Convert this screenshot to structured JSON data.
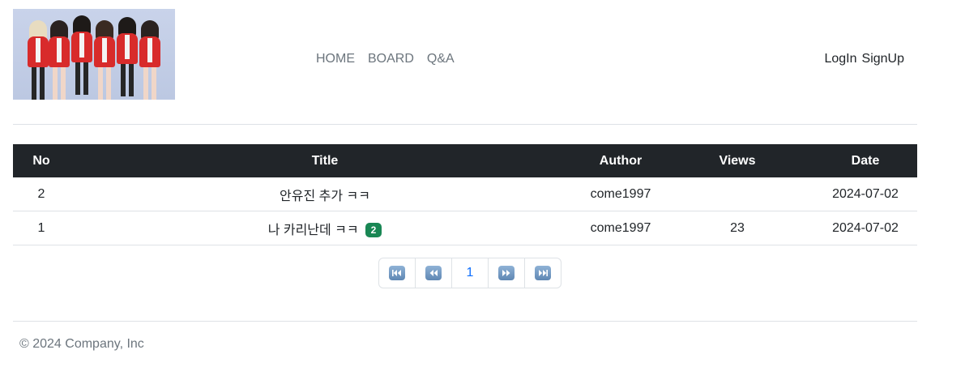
{
  "nav": {
    "items": [
      "HOME",
      "BOARD",
      "Q&A"
    ]
  },
  "auth": {
    "login": "LogIn",
    "signup": "SignUp"
  },
  "table": {
    "headers": [
      "No",
      "Title",
      "Author",
      "Views",
      "Date"
    ],
    "rows": [
      {
        "no": "2",
        "title": "안유진 추가 ㅋㅋ",
        "badge": "",
        "author": "come1997",
        "views": "",
        "date": "2024-07-02"
      },
      {
        "no": "1",
        "title": "나 카리난데 ㅋㅋ",
        "badge": "2",
        "author": "come1997",
        "views": "23",
        "date": "2024-07-02"
      }
    ]
  },
  "pagination": {
    "first_icon": "first-page-icon",
    "prev_icon": "prev-page-icon",
    "current": "1",
    "next_icon": "next-page-icon",
    "last_icon": "last-page-icon"
  },
  "footer": {
    "text": "© 2024 Company, Inc"
  },
  "colors": {
    "header_bg": "#212529",
    "badge_bg": "#198754",
    "link": "#0d6efd",
    "muted": "#6c757d"
  }
}
